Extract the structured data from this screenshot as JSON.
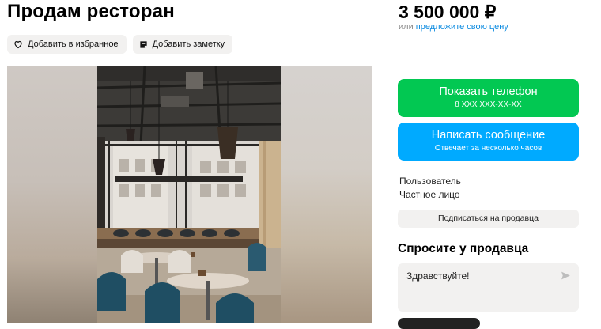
{
  "listing": {
    "title": "Продам ресторан",
    "price": "3 500 000 ₽",
    "price_or": "или",
    "price_offer_link": "предложите свою цену"
  },
  "actions": {
    "favorite_label": "Добавить в избранное",
    "note_label": "Добавить заметку",
    "favorite_icon": "heart-icon",
    "note_icon": "note-icon"
  },
  "contact": {
    "phone_label": "Показать телефон",
    "phone_masked": "8 XXX XXX-XX-XX",
    "message_label": "Написать сообщение",
    "message_sub": "Отвечает за несколько часов",
    "phone_color": "#02c852",
    "message_color": "#00aaff"
  },
  "seller": {
    "role": "Пользователь",
    "type": "Частное лицо",
    "subscribe_label": "Подписаться на продавца"
  },
  "ask": {
    "title": "Спросите у продавца",
    "message_value": "Здравствуйте!",
    "send_icon": "send-icon"
  },
  "gallery": {
    "image": "restaurant-interior-photo"
  }
}
